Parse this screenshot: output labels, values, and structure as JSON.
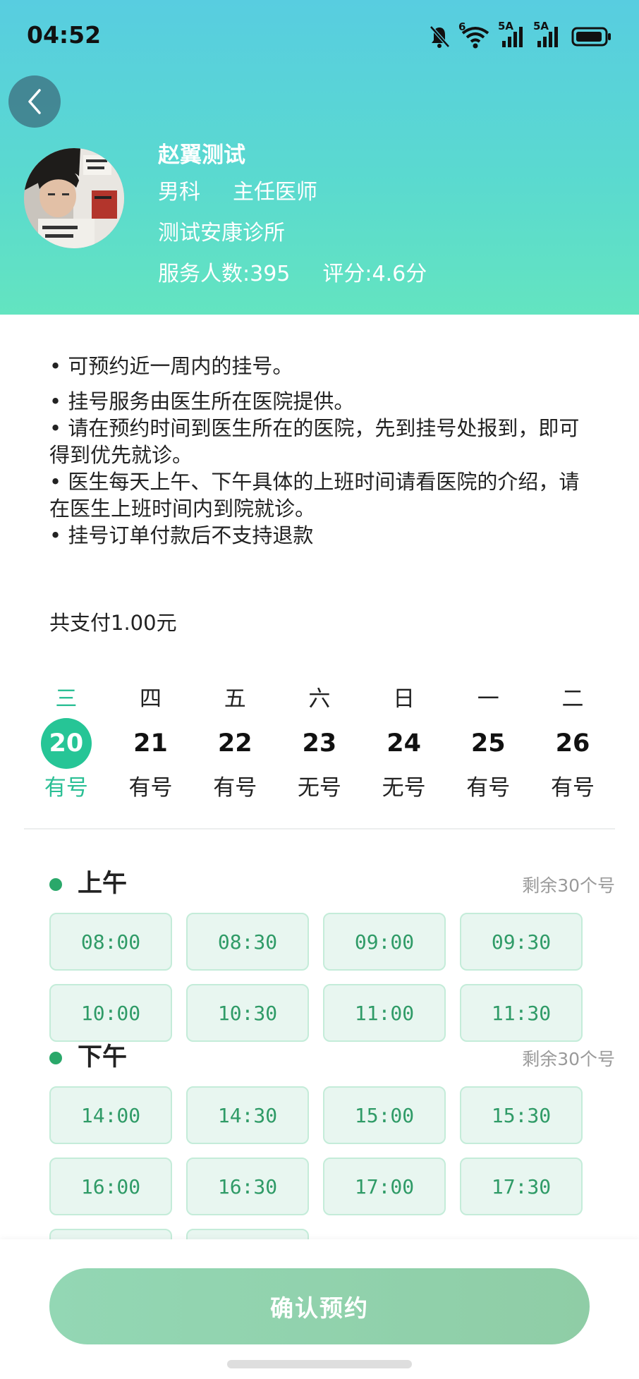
{
  "status_bar": {
    "time": "04:52",
    "icons": [
      "bell-muted-icon",
      "wifi-icon",
      "signal-5a-icon",
      "signal-5a-icon",
      "battery-icon"
    ],
    "wifi_badge": "6",
    "sim1_badge": "5A",
    "sim2_badge": "5A"
  },
  "doctor": {
    "name": "赵翼测试",
    "department": "男科",
    "title": "主任医师",
    "clinic": "测试安康诊所",
    "served": "服务人数:395",
    "rating": "评分:4.6分"
  },
  "notice": [
    "• 可预约近一周内的挂号。",
    "• 挂号服务由医生所在医院提供。\n• 请在预约时间到医生所在的医院，先到挂号处报到，即可得到优先就诊。\n• 医生每天上午、下午具体的上班时间请看医院的介绍，请在医生上班时间内到院就诊。\n• 挂号订单付款后不支持退款"
  ],
  "payment": {
    "total": "共支付1.00元"
  },
  "dates": [
    {
      "weekday": "三",
      "day": "20",
      "status": "有号",
      "selected": true
    },
    {
      "weekday": "四",
      "day": "21",
      "status": "有号",
      "selected": false
    },
    {
      "weekday": "五",
      "day": "22",
      "status": "有号",
      "selected": false
    },
    {
      "weekday": "六",
      "day": "23",
      "status": "无号",
      "selected": false
    },
    {
      "weekday": "日",
      "day": "24",
      "status": "无号",
      "selected": false
    },
    {
      "weekday": "一",
      "day": "25",
      "status": "有号",
      "selected": false
    },
    {
      "weekday": "二",
      "day": "26",
      "status": "有号",
      "selected": false
    }
  ],
  "morning": {
    "label": "上午",
    "remaining": "剩余30个号",
    "slots": [
      "08:00",
      "08:30",
      "09:00",
      "09:30",
      "10:00",
      "10:30",
      "11:00",
      "11:30"
    ]
  },
  "afternoon": {
    "label": "下午",
    "remaining": "剩余30个号",
    "slots": [
      "14:00",
      "14:30",
      "15:00",
      "15:30",
      "16:00",
      "16:30",
      "17:00",
      "17:30"
    ]
  },
  "actions": {
    "confirm": "确认预约"
  },
  "colors": {
    "accent": "#26c596",
    "slot_text": "#2f9b67",
    "header_top": "#58cde0",
    "header_bottom": "#63e4c0"
  }
}
